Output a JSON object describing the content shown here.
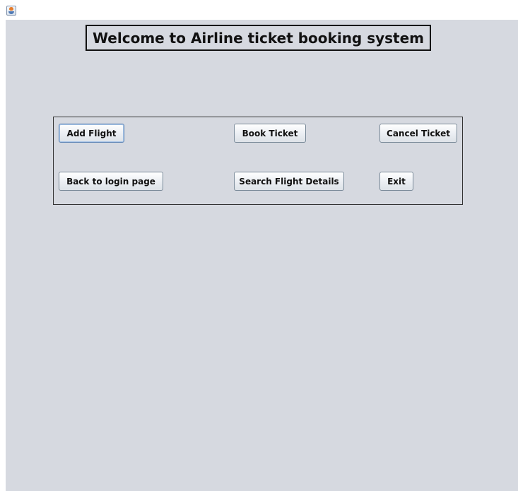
{
  "window": {
    "icon": "java-cup-icon"
  },
  "heading": {
    "title": "Welcome to Airline ticket booking system"
  },
  "buttons": {
    "add_flight": "Add Flight",
    "book_ticket": "Book Ticket",
    "cancel_ticket": "Cancel Ticket",
    "back_to_login": "Back to login page",
    "search_flight_details": "Search Flight Details",
    "exit": "Exit"
  },
  "colors": {
    "background": "#d6d9e0",
    "border": "#111111",
    "focus_border": "#5f86b6"
  }
}
